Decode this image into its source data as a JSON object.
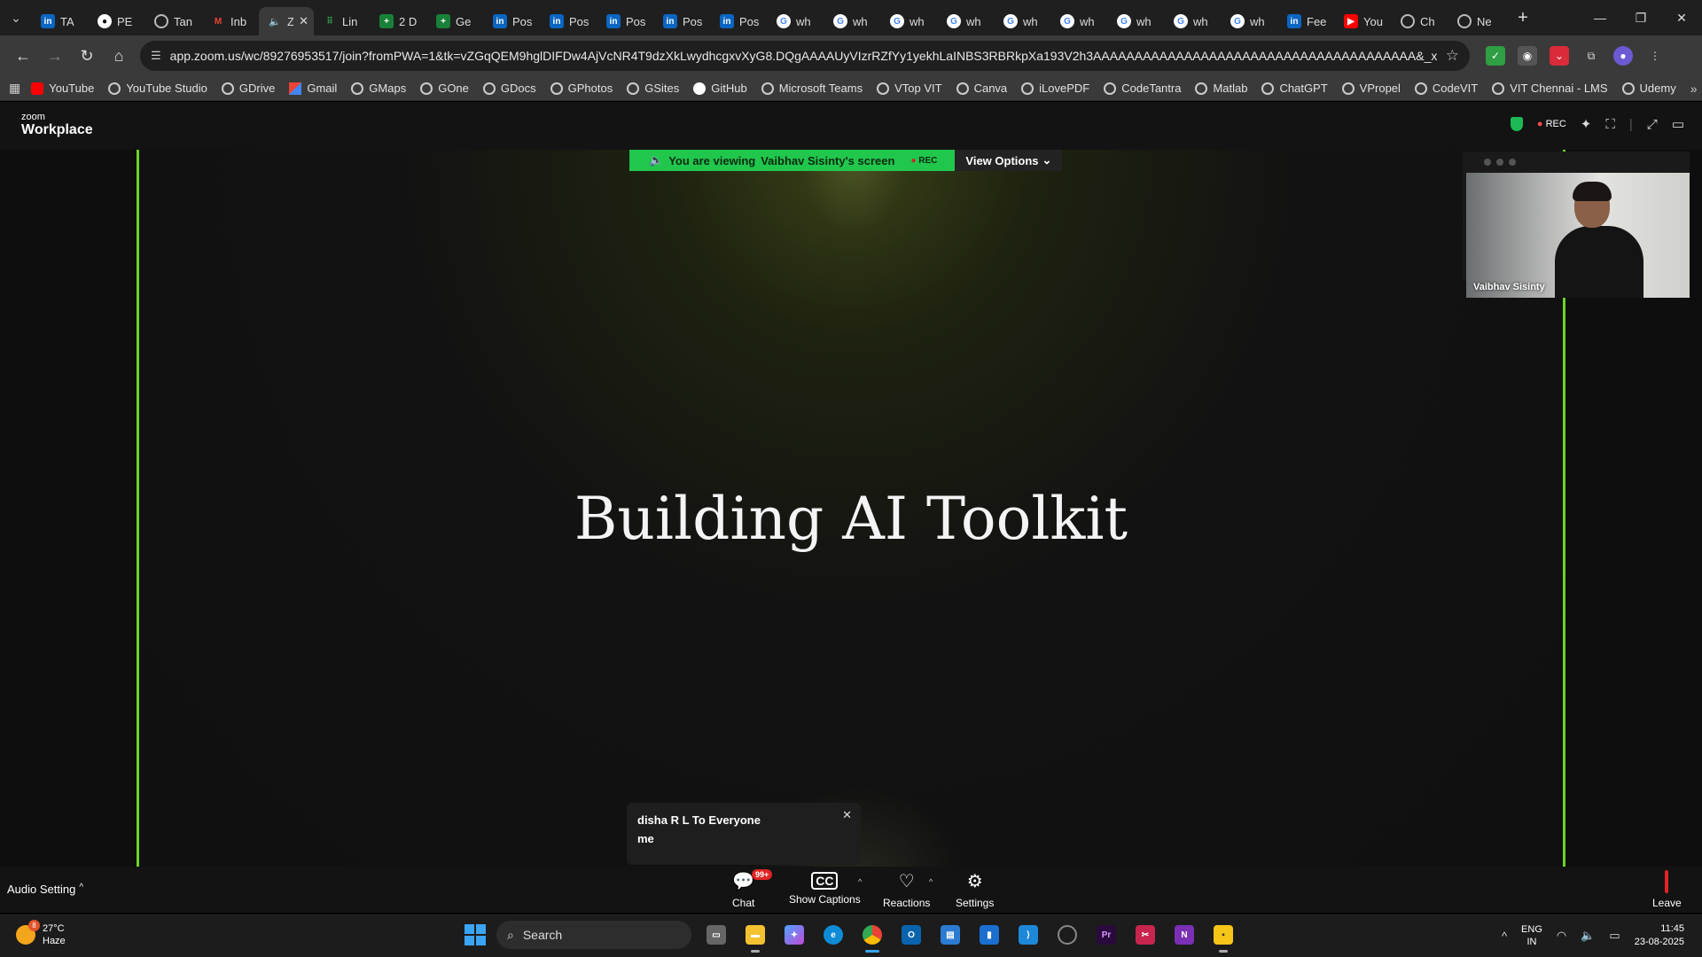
{
  "browser": {
    "tabs": [
      {
        "icon": "linkedin",
        "title": "TA"
      },
      {
        "icon": "github",
        "title": "PE"
      },
      {
        "icon": "globe",
        "title": "Tan"
      },
      {
        "icon": "gmail",
        "title": "Inb"
      },
      {
        "icon": "audio",
        "title": "Z",
        "active": true
      },
      {
        "icon": "dots",
        "title": "Lin"
      },
      {
        "icon": "sheets",
        "title": "2 D"
      },
      {
        "icon": "sheets",
        "title": "Ge"
      },
      {
        "icon": "linkedin",
        "title": "Pos"
      },
      {
        "icon": "linkedin",
        "title": "Pos"
      },
      {
        "icon": "linkedin",
        "title": "Pos"
      },
      {
        "icon": "linkedin",
        "title": "Pos"
      },
      {
        "icon": "linkedin",
        "title": "Pos"
      },
      {
        "icon": "google",
        "title": "wh"
      },
      {
        "icon": "google",
        "title": "wh"
      },
      {
        "icon": "google",
        "title": "wh"
      },
      {
        "icon": "google",
        "title": "wh"
      },
      {
        "icon": "google",
        "title": "wh"
      },
      {
        "icon": "google",
        "title": "wh"
      },
      {
        "icon": "google",
        "title": "wh"
      },
      {
        "icon": "google",
        "title": "wh"
      },
      {
        "icon": "google",
        "title": "wh"
      },
      {
        "icon": "linkedin",
        "title": "Fee"
      },
      {
        "icon": "youtube",
        "title": "You"
      },
      {
        "icon": "globe",
        "title": "Ch"
      },
      {
        "icon": "globe",
        "title": "Ne"
      }
    ],
    "url": "app.zoom.us/wc/89276953517/join?fromPWA=1&tk=vZGqQEM9hglDIFDw4AjVcNR4T9dzXkLwydhcgxvXyG8.DQgAAAAUyVIzrRZfYy1yekhLaINBS3RBRkpXa193V2h3AAAAAAAAAAAAAAAAAAAAAAAAAAAAAAAAAAAAAAA&_x_zm_r...",
    "bookmarks": [
      "YouTube",
      "YouTube Studio",
      "GDrive",
      "Gmail",
      "GMaps",
      "GOne",
      "GDocs",
      "GPhotos",
      "GSites",
      "GitHub",
      "Microsoft Teams",
      "VTop VIT",
      "Canva",
      "iLovePDF",
      "CodeTantra",
      "Matlab",
      "ChatGPT",
      "VPropel",
      "CodeVIT",
      "VIT Chennai - LMS",
      "Udemy"
    ]
  },
  "zoom": {
    "logo_small": "zoom",
    "logo_big": "Workplace",
    "rec_label": "REC",
    "banner_prefix": "You are viewing",
    "banner_name": "Vaibhav Sisinty's screen",
    "banner_rec": "REC",
    "view_options": "View Options",
    "slide_title": "Building AI Toolkit",
    "video_name": "Vaibhav Sisinty",
    "chat_from": "disha R L To Everyone",
    "chat_message": "me",
    "audio_setting": "Audio Setting",
    "chat_label": "Chat",
    "chat_badge": "99+",
    "captions_label": "Show Captions",
    "reactions_label": "Reactions",
    "settings_label": "Settings",
    "leave_label": "Leave"
  },
  "taskbar": {
    "weather_badge": "8",
    "temperature": "27°C",
    "condition": "Haze",
    "search_label": "Search",
    "lang_top": "ENG",
    "lang_bottom": "IN",
    "time": "11:45",
    "date": "23-08-2025"
  },
  "colors": {
    "share_border": "#6cd425",
    "banner_green": "#21c74c",
    "rec_red": "#ff4b4b"
  }
}
